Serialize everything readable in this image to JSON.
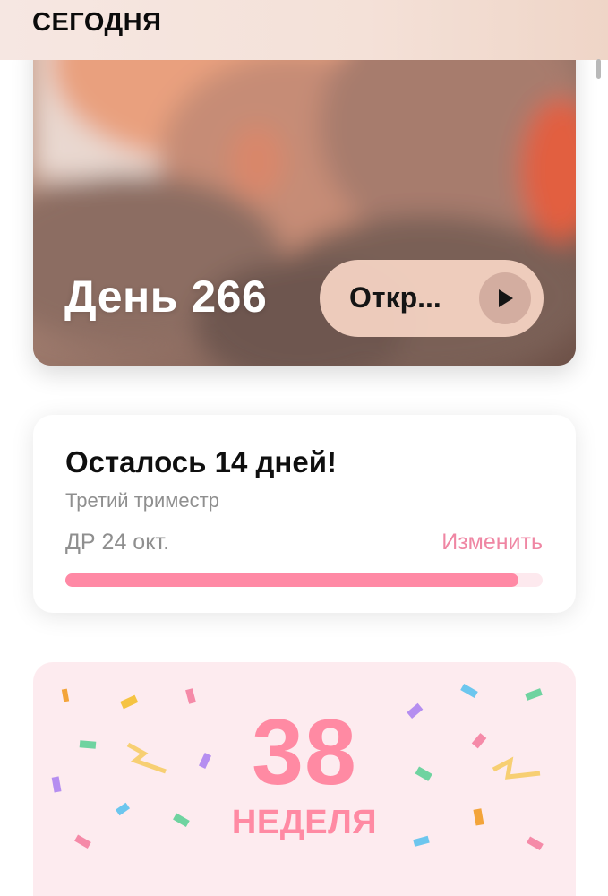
{
  "header": {
    "title": "СЕГОДНЯ"
  },
  "hero": {
    "title": "День 266",
    "open_button_label": "Откр...",
    "play_icon": "play-icon"
  },
  "countdown": {
    "title": "Осталось 14 дней!",
    "trimester": "Третий триместр",
    "due_date": "ДР 24 окт.",
    "change_label": "Изменить",
    "progress": 0.95
  },
  "week": {
    "number": "38",
    "label": "НЕДЕЛЯ"
  },
  "colors": {
    "accent_pink": "#ff8aa3",
    "link_pink": "#ef86a3",
    "progress_track": "#fde9ee",
    "week_card_bg": "#fdebef"
  }
}
